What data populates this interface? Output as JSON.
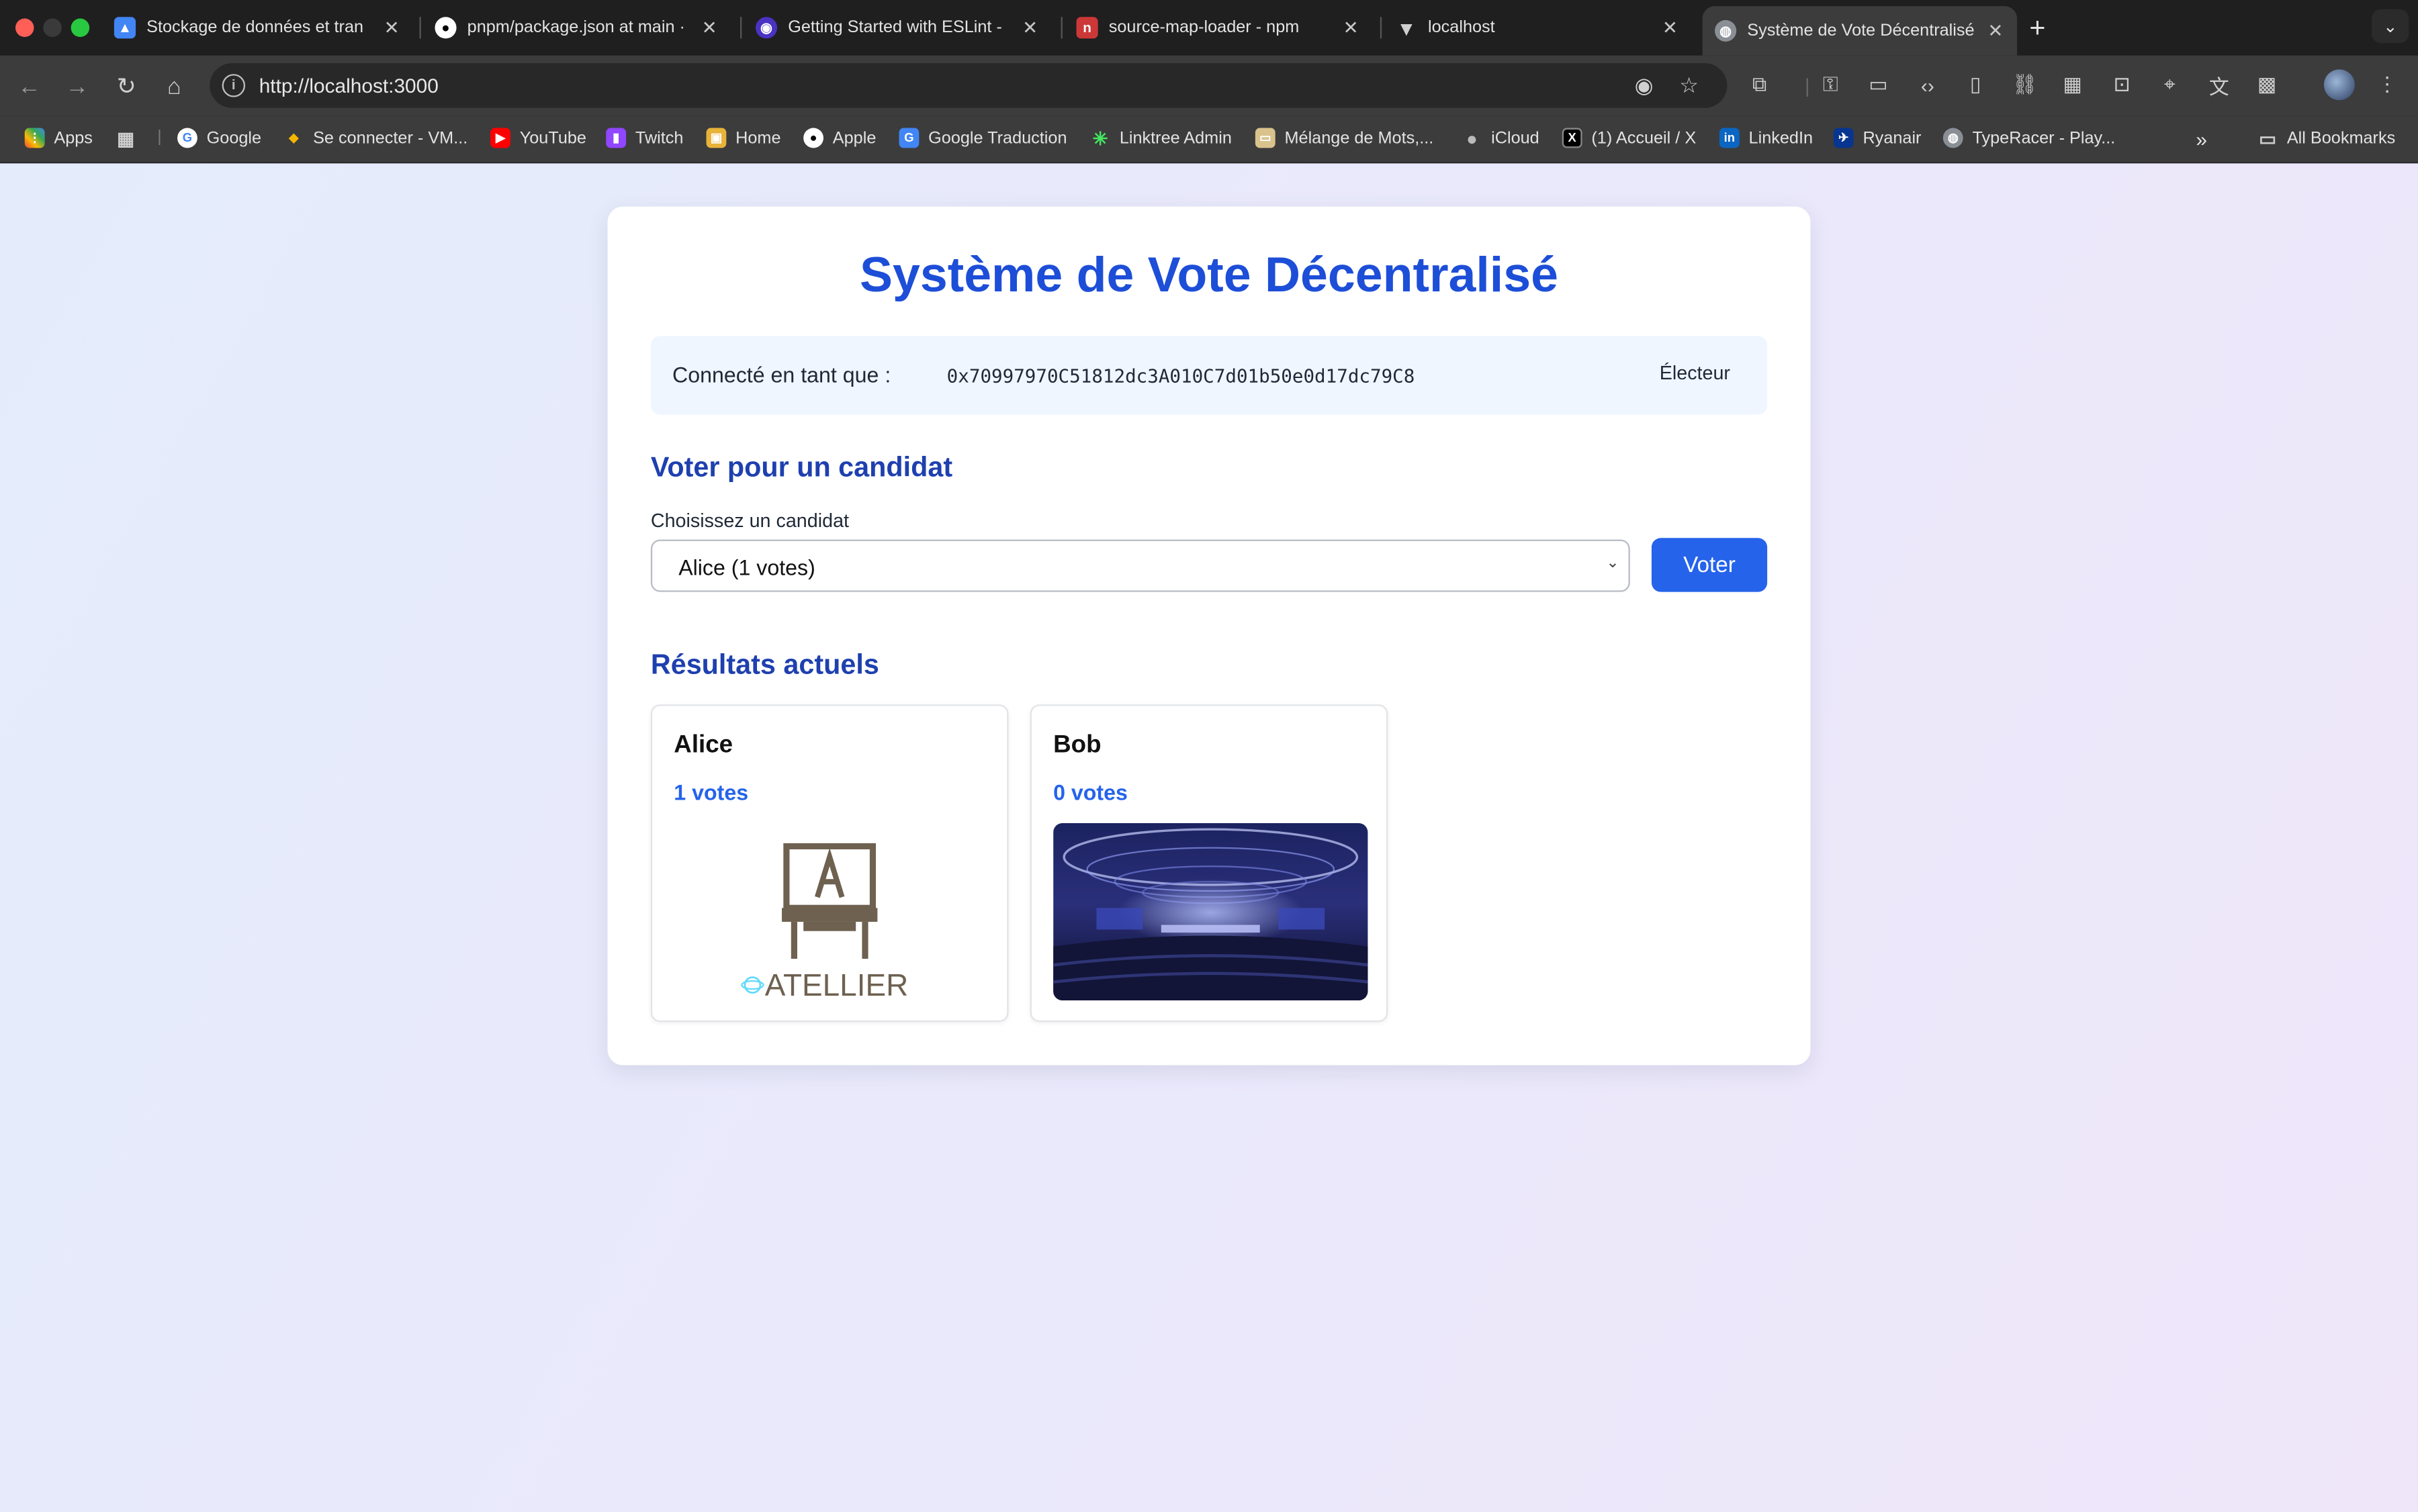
{
  "browser": {
    "tabs": [
      {
        "label": "Stockage de données et tran",
        "favicon": "google-classroom-icon",
        "color": "#4285f4",
        "active": false
      },
      {
        "label": "pnpm/package.json at main ·",
        "favicon": "github-icon",
        "color": "#ffffff",
        "active": false
      },
      {
        "label": "Getting Started with ESLint -",
        "favicon": "eslint-icon",
        "color": "#4b32c3",
        "active": false
      },
      {
        "label": "source-map-loader - npm",
        "favicon": "npm-icon",
        "color": "#cb3837",
        "active": false
      },
      {
        "label": "localhost",
        "favicon": "vite-icon",
        "color": "#bbbbbb",
        "active": false
      },
      {
        "label": "Système de Vote Décentralisé",
        "favicon": "globe-icon",
        "color": "#9aa0a6",
        "active": true
      }
    ],
    "url": "http://localhost:3000",
    "bookmarks": [
      {
        "label": "Apps",
        "icon": "apps-grid-icon",
        "color": "#ea4335"
      },
      {
        "label": "",
        "icon": "tab-groups-icon",
        "color": "#888888"
      },
      {
        "label": "Google",
        "icon": "google-icon",
        "color": "#4285f4"
      },
      {
        "label": "Se connecter - VM...",
        "icon": "vmware-icon",
        "color": "#f5b400"
      },
      {
        "label": "YouTube",
        "icon": "youtube-icon",
        "color": "#ff0000"
      },
      {
        "label": "Twitch",
        "icon": "twitch-icon",
        "color": "#9146ff"
      },
      {
        "label": "Home",
        "icon": "home-bookmark-icon",
        "color": "#e8b339"
      },
      {
        "label": "Apple",
        "icon": "apple-icon",
        "color": "#ffffff"
      },
      {
        "label": "Google Traduction",
        "icon": "google-translate-icon",
        "color": "#4285f4"
      },
      {
        "label": "Linktree Admin",
        "icon": "linktree-icon",
        "color": "#43e660"
      },
      {
        "label": "Mélange de Mots,...",
        "icon": "word-game-icon",
        "color": "#d9c28b"
      },
      {
        "label": "iCloud",
        "icon": "apple-icon",
        "color": "#bbbbbb"
      },
      {
        "label": "(1) Accueil / X",
        "icon": "x-icon",
        "color": "#000000"
      },
      {
        "label": "LinkedIn",
        "icon": "linkedin-icon",
        "color": "#0a66c2"
      },
      {
        "label": "Ryanair",
        "icon": "ryanair-icon",
        "color": "#073590"
      },
      {
        "label": "TypeRacer - Play...",
        "icon": "globe-icon",
        "color": "#9aa0a6"
      }
    ],
    "all_bookmarks": "All Bookmarks"
  },
  "app": {
    "title": "Système de Vote Décentralisé",
    "account_label": "Connecté en tant que :",
    "account_address": "0x70997970C51812dc3A010C7d01b50e0d17dc79C8",
    "role": "Électeur",
    "vote_heading": "Voter pour un candidat",
    "select_label": "Choisissez un candidat",
    "select_value": "Alice (1 votes)",
    "vote_button": "Voter",
    "results_heading": "Résultats actuels",
    "candidates": [
      {
        "name": "Alice",
        "votes_text": "1 votes",
        "votes": 1,
        "image": "atellier-logo",
        "logo_text": "ATELLIER"
      },
      {
        "name": "Bob",
        "votes_text": "0 votes",
        "votes": 0,
        "image": "conference-stage-photo"
      }
    ],
    "colors": {
      "primary": "#2563eb",
      "title": "#1d4ed8",
      "heading": "#1e40af"
    }
  }
}
